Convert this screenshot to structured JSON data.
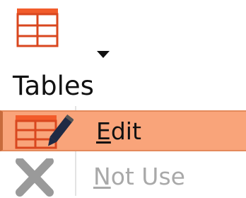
{
  "ribbon": {
    "tables_label": "Tables",
    "icon": "table-icon",
    "dropdown_icon": "dropdown-arrow-icon"
  },
  "menu": {
    "items": [
      {
        "mnemonic": "E",
        "rest": "dit",
        "icon": "edit-table-icon",
        "highlighted": true,
        "enabled": true
      },
      {
        "mnemonic": "N",
        "rest": "ot Use",
        "icon": "not-use-x-icon",
        "highlighted": false,
        "enabled": false
      }
    ]
  },
  "colors": {
    "accent_orange": "#f25c2b",
    "highlight": "#f9a47a",
    "disabled_text": "#a9a9a9"
  }
}
